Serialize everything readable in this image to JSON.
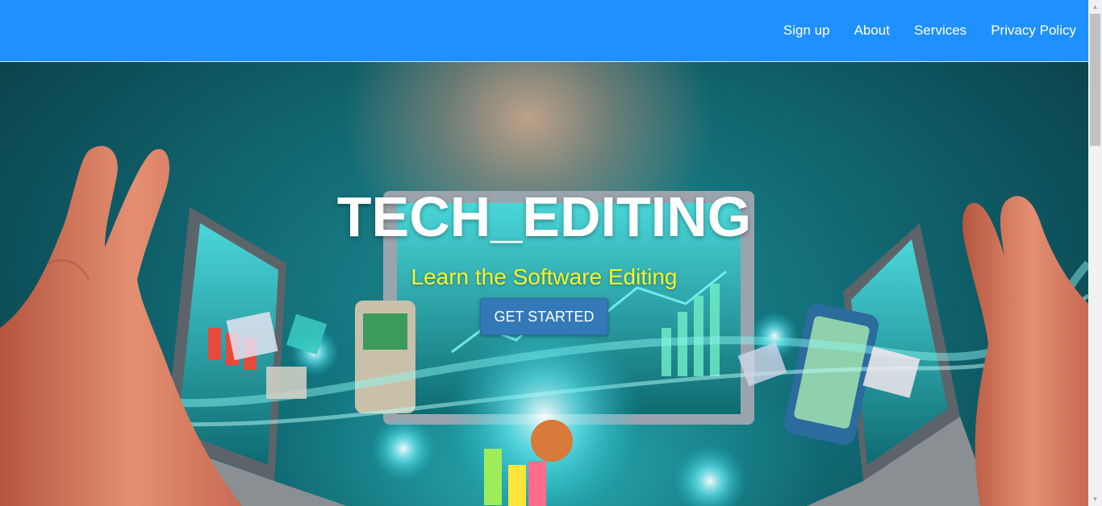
{
  "nav": {
    "items": [
      {
        "label": "Sign up"
      },
      {
        "label": "About"
      },
      {
        "label": "Services"
      },
      {
        "label": "Privacy Policy"
      }
    ]
  },
  "hero": {
    "title": "TECH_EDITING",
    "subtitle": "Learn the Software Editing",
    "cta_label": "GET STARTED",
    "background_icon": "tech-collage-image"
  },
  "colors": {
    "navbar": "#1e90ff",
    "subtitle": "#f5f52a",
    "button": "#3479b7",
    "text": "#ffffff"
  },
  "scrollbar": {
    "up_icon": "scroll-up-arrow-icon",
    "down_icon": "scroll-down-arrow-icon"
  }
}
